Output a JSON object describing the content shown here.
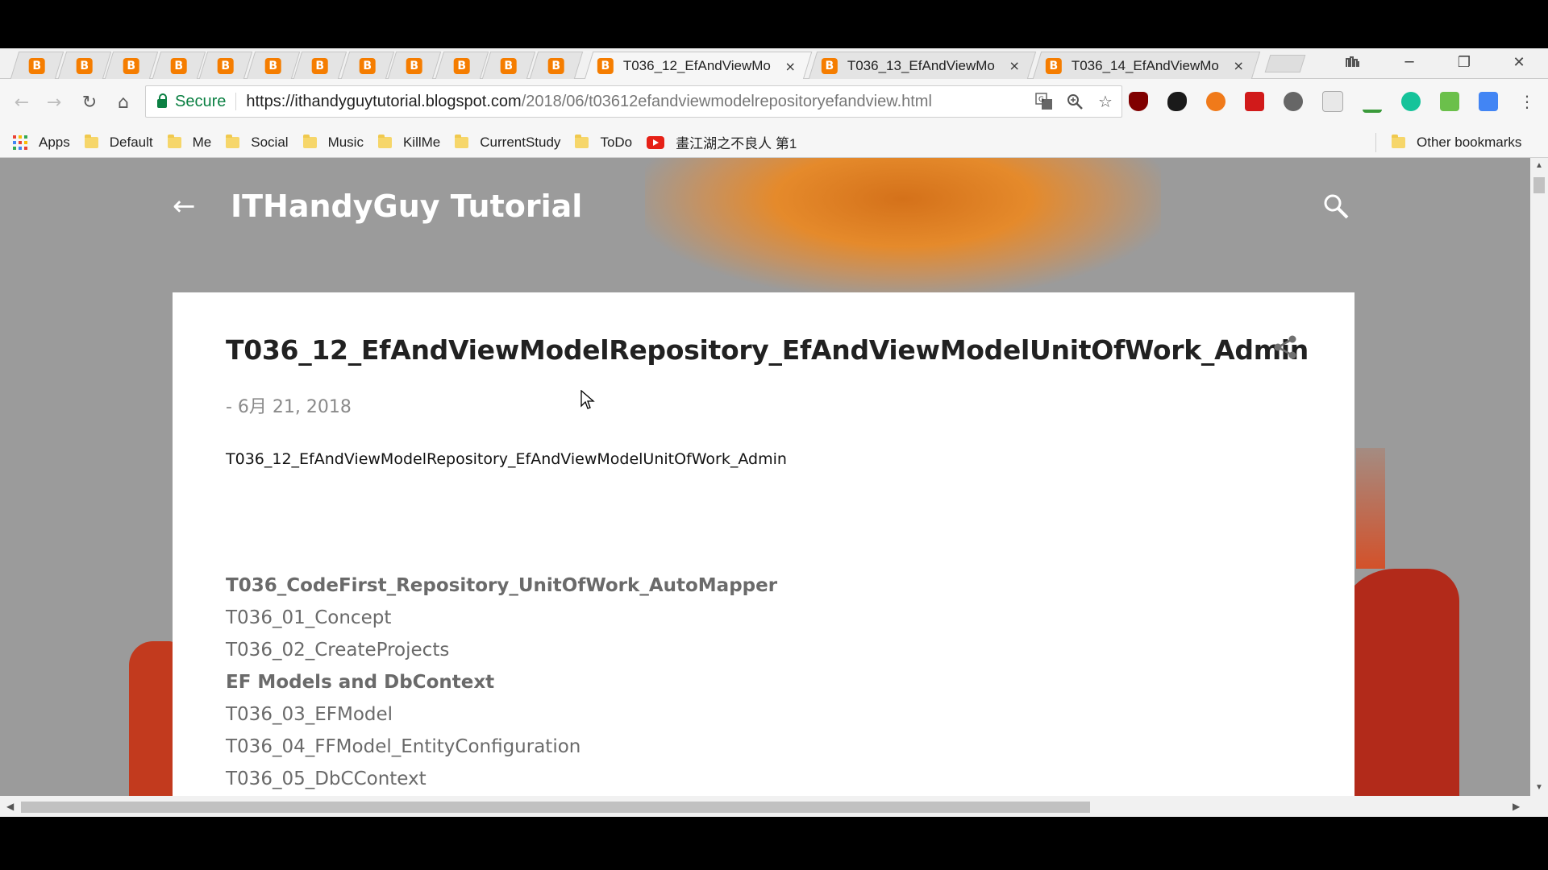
{
  "browser": {
    "tabs": [
      {
        "title": "T036_12_EfAndViewMo",
        "active": true,
        "close": "×"
      },
      {
        "title": "T036_13_EfAndViewMo",
        "active": false,
        "close": "×"
      },
      {
        "title": "T036_14_EfAndViewMo",
        "active": false,
        "close": "×"
      }
    ],
    "pinned_tab_favicon": "B",
    "window_controls": {
      "minimize": "─",
      "restore": "❐",
      "close": "✕"
    },
    "omnibox": {
      "secure_label": "Secure",
      "url_host": "https://ithandyguytutorial.blogspot.com",
      "url_path": "/2018/06/t03612efandviewmodelrepositoryefandview.html"
    },
    "bookmarks": [
      {
        "label": "Apps",
        "icon": "apps-grid-icon"
      },
      {
        "label": "Default",
        "icon": "folder-icon"
      },
      {
        "label": "Me",
        "icon": "folder-icon"
      },
      {
        "label": "Social",
        "icon": "folder-icon"
      },
      {
        "label": "Music",
        "icon": "folder-icon"
      },
      {
        "label": "KillMe",
        "icon": "folder-icon"
      },
      {
        "label": "CurrentStudy",
        "icon": "folder-icon"
      },
      {
        "label": "ToDo",
        "icon": "folder-icon"
      },
      {
        "label": "畫江湖之不良人 第1",
        "icon": "youtube-icon"
      }
    ],
    "other_bookmarks": "Other bookmarks"
  },
  "blog": {
    "title": "ITHandyGuy Tutorial",
    "post_title": "T036_12_EfAndViewModelRepository_EfAndViewModelUnitOfWork_Admin",
    "post_date": "- 6月 21, 2018",
    "post_subtitle": "T036_12_EfAndViewModelRepository_EfAndViewModelUnitOfWork_Admin",
    "toc": [
      {
        "text": "T036_CodeFirst_Repository_UnitOfWork_AutoMapper",
        "bold": true
      },
      {
        "text": "T036_01_Concept",
        "bold": false
      },
      {
        "text": "T036_02_CreateProjects",
        "bold": false
      },
      {
        "text": "EF Models and DbContext",
        "bold": true
      },
      {
        "text": "T036_03_EFModel",
        "bold": false
      },
      {
        "text": "T036_04_FFModel_EntityConfiguration",
        "bold": false
      },
      {
        "text": "T036_05_DbCContext",
        "bold": false
      }
    ]
  },
  "colors": {
    "blogger_orange": "#f57d00",
    "secure_green": "#0b8043",
    "backdrop_gray": "#9b9b9b",
    "tree_orange": "#e58a2b",
    "figure_red": "#b22a1a"
  }
}
